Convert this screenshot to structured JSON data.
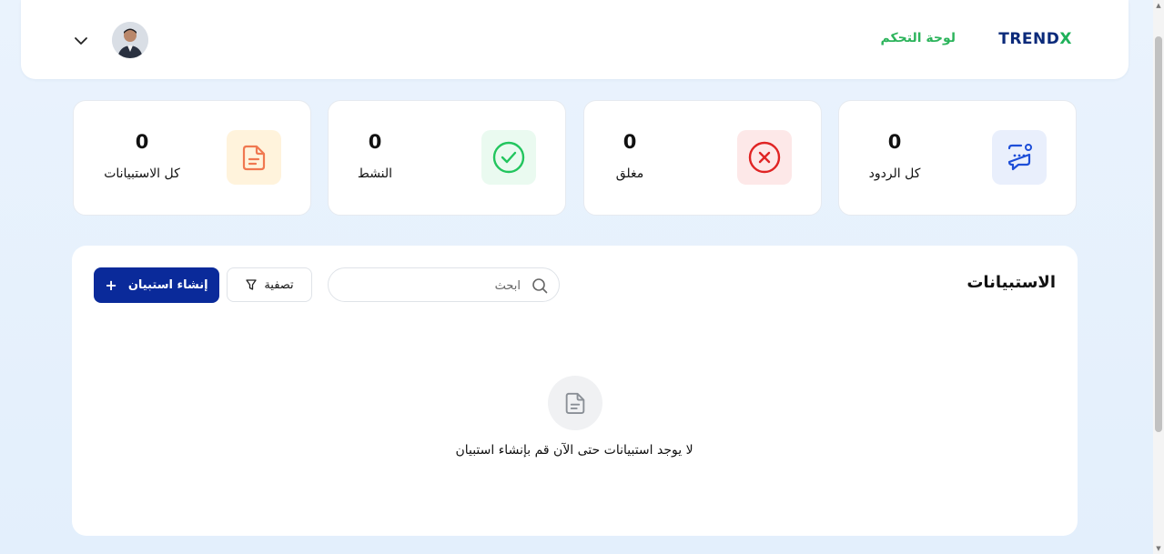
{
  "header": {
    "logo_main": "TREND",
    "logo_accent": "X",
    "nav_title": "لوحة التحكم"
  },
  "stats": [
    {
      "value": "0",
      "label": "كل الردود",
      "icon": "chat-bubble-icon",
      "color": "#1d4ed8",
      "bg": "#e9effc"
    },
    {
      "value": "0",
      "label": "مغلق",
      "icon": "close-circle-icon",
      "color": "#e02424",
      "bg": "#fde8e8"
    },
    {
      "value": "0",
      "label": "النشط",
      "icon": "check-circle-icon",
      "color": "#22c55e",
      "bg": "#eafaf0"
    },
    {
      "value": "0",
      "label": "كل الاستبيانات",
      "icon": "document-icon",
      "color": "#f07850",
      "bg": "#fff3dc"
    }
  ],
  "surveys": {
    "title": "الاستبيانات",
    "search_placeholder": "ابحث",
    "filter_label": "تصفية",
    "create_label": "إنشاء استبيان",
    "create_plus": "+",
    "empty_text": "لا يوجد استبيانات حتى الآن قم بإنشاء استبيان"
  },
  "colors": {
    "primary": "#0a2a9a",
    "accent_green": "#2db45c",
    "logo_navy": "#0b2a7a"
  }
}
